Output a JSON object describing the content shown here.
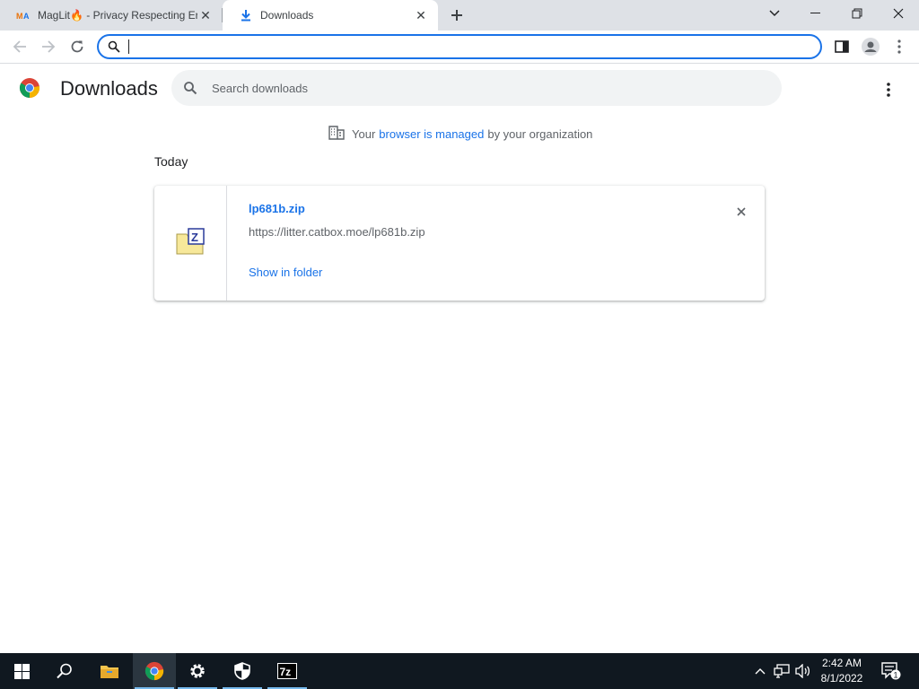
{
  "tabs": [
    {
      "label": "MagLit🔥 - Privacy Respecting Er",
      "favicon": "maglit-icon",
      "active": false
    },
    {
      "label": "Downloads",
      "favicon": "download-icon",
      "active": true
    }
  ],
  "omnibox": {
    "value": "",
    "placeholder": ""
  },
  "downloads": {
    "title": "Downloads",
    "search_placeholder": "Search downloads",
    "managed_notice": {
      "prefix": "Your",
      "link": "browser is managed",
      "suffix": "by your organization"
    },
    "section_label": "Today",
    "items": [
      {
        "file_name": "lp681b.zip",
        "url": "https://litter.catbox.moe/lp681b.zip",
        "action": "Show in folder"
      }
    ]
  },
  "taskbar": {
    "apps": [
      "start-icon",
      "search-icon",
      "file-explorer-icon",
      "chrome-icon",
      "settings-icon",
      "windows-security-icon",
      "7zip-icon"
    ],
    "time": "2:42 AM",
    "date": "8/1/2022",
    "notification_count": "1"
  },
  "colors": {
    "accent": "#1a73e8",
    "taskbar": "#101820",
    "tabstrip": "#dee1e6"
  }
}
